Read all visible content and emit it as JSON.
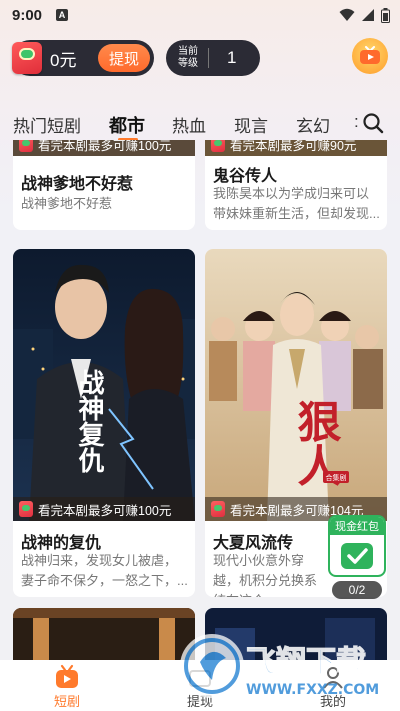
{
  "status_bar": {
    "time": "9:00",
    "notification_letter": "A"
  },
  "header": {
    "wallet_amount": "0元",
    "withdraw_label": "提现",
    "level_label": "当前等级",
    "level_value": "1"
  },
  "tabs": [
    {
      "label": "热门短剧"
    },
    {
      "label": "都市"
    },
    {
      "label": "热血"
    },
    {
      "label": "现言"
    },
    {
      "label": "玄幻"
    },
    {
      "label": ":"
    }
  ],
  "active_tab": "都市",
  "cards": [
    {
      "earn": "看完本剧最多可赚100元",
      "title": "战神爹地不好惹",
      "desc": "战神爹地不好惹"
    },
    {
      "earn": "看完本剧最多可赚90元",
      "title": "鬼谷传人",
      "desc": "我陈昊本以为学成归来可以带妹妹重新生活，但却发现..."
    },
    {
      "earn": "看完本剧最多可赚100元",
      "title": "战神的复仇",
      "desc": "战神归来，发现女儿被虐，妻子命不保夕，一怒之下，..."
    },
    {
      "earn": "看完本剧最多可赚104元",
      "title": "大夏风流传",
      "desc": "现代小伙意外穿越，机积分兑换系统在这个..."
    }
  ],
  "posters": [
    {
      "title_art": "战神复仇"
    },
    {
      "title_art": "狠人",
      "badge": "合集剧"
    }
  ],
  "red_packet": {
    "label": "现金红包",
    "counter": "0/2"
  },
  "bottom_nav": [
    {
      "label": "短剧"
    },
    {
      "label": "提现"
    },
    {
      "label": "我的"
    }
  ],
  "watermark": {
    "text": "飞翔下载",
    "url": "WWW.FXXZ.COM"
  },
  "colors": {
    "accent": "#ff7a2c",
    "dark_pill": "#2b2b35",
    "green": "#2fb35c"
  }
}
